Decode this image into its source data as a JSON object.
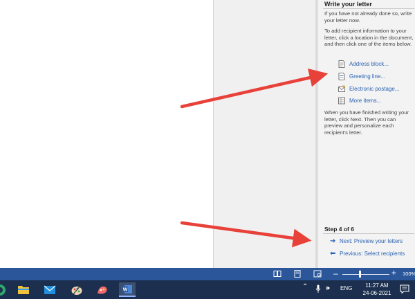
{
  "pane": {
    "title": "Write your letter",
    "intro": "If you have not already done so, write your letter now.",
    "instructions": "To add recipient information to your letter, click a location in the document, and then click one of the items below.",
    "items": [
      {
        "label": "Address block...",
        "icon": "address-block-icon"
      },
      {
        "label": "Greeting line...",
        "icon": "greeting-line-icon"
      },
      {
        "label": "Electronic postage...",
        "icon": "electronic-postage-icon"
      },
      {
        "label": "More items...",
        "icon": "more-items-icon"
      }
    ],
    "finish_text": "When you have finished writing your letter, click Next. Then you can preview and personalize each recipient's letter.",
    "step": "Step 4 of 6",
    "next_label": "Next: Preview your letters",
    "previous_label": "Previous: Select recipients"
  },
  "statusbar": {
    "zoom_level": "100%",
    "zoom_fraction": 0.38
  },
  "taskbar": {
    "tray_language": "ENG",
    "clock_time": "11:27 AM",
    "clock_date": "24-06-2021"
  },
  "colors": {
    "link": "#2a63b1",
    "statusbar": "#2b579a",
    "taskbar": "#1c2f4f",
    "annotation_arrow": "#e8413a"
  }
}
